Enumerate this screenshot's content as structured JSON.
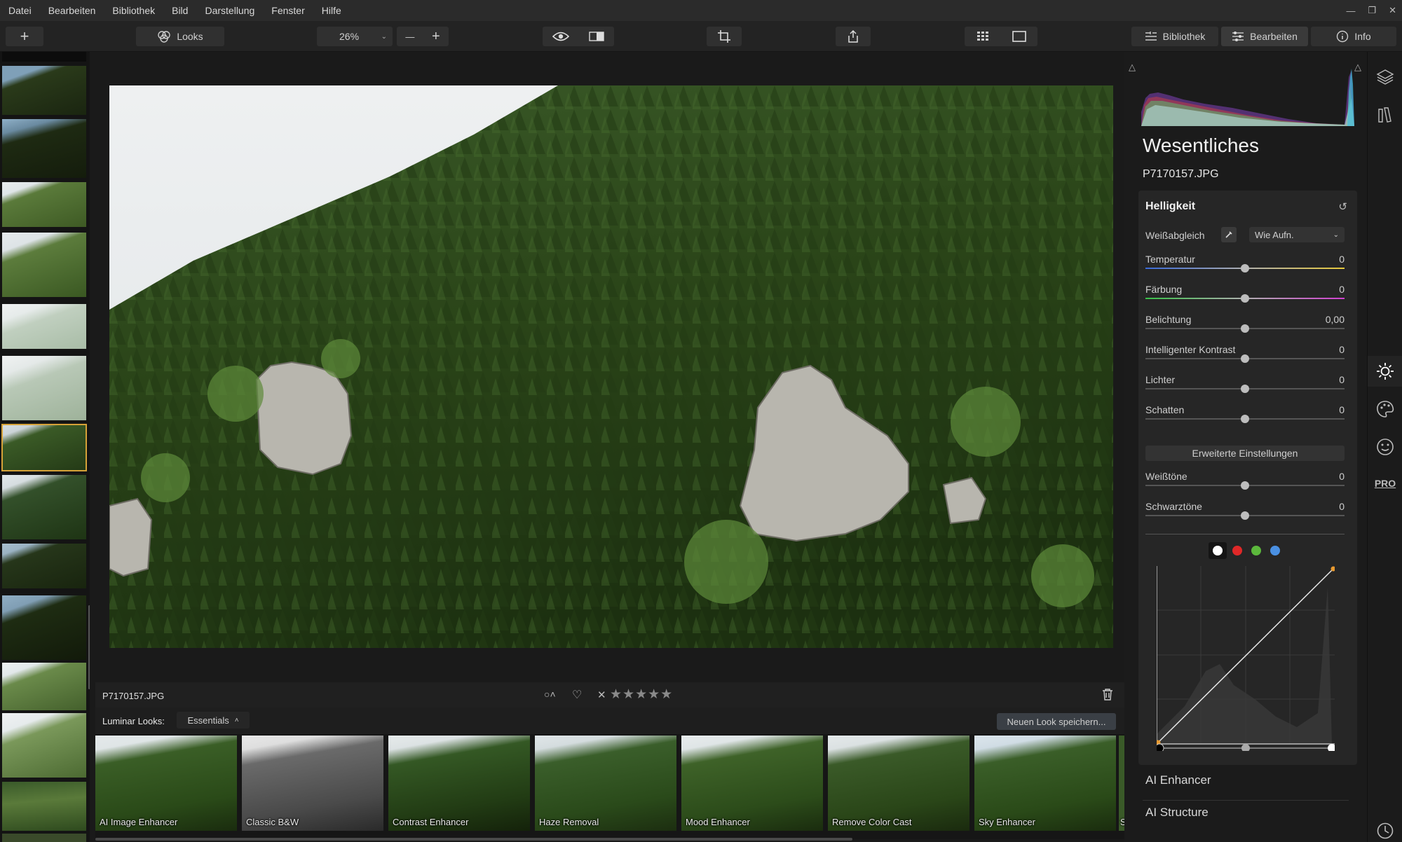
{
  "menu": [
    "Datei",
    "Bearbeiten",
    "Bibliothek",
    "Bild",
    "Darstellung",
    "Fenster",
    "Hilfe"
  ],
  "window_controls": {
    "minimize": "—",
    "maximize": "❐",
    "close": "✕"
  },
  "toolbar": {
    "add_label": "+",
    "looks_label": "Looks",
    "zoom_value": "26%",
    "zoom_out": "—",
    "zoom_in": "+",
    "tabs": {
      "library": "Bibliothek",
      "edit": "Bearbeiten",
      "info": "Info"
    }
  },
  "info_bar": {
    "filename": "P7170157.JPG",
    "rating_stars": "★★★★★",
    "reject": "✕",
    "rating": 0
  },
  "looks_bar": {
    "label": "Luminar Looks:",
    "category": "Essentials",
    "save_button": "Neuen Look speichern...",
    "items": [
      "AI Image Enhancer",
      "Classic B&W",
      "Contrast Enhancer",
      "Haze Removal",
      "Mood Enhancer",
      "Remove Color Cast",
      "Sky Enhancer",
      "Sc"
    ]
  },
  "panel": {
    "title": "Wesentliches",
    "filename": "P7170157.JPG",
    "section": "Helligkeit",
    "wb_label": "Weißabgleich",
    "wb_value": "Wie Aufn.",
    "sliders": [
      {
        "name": "Temperatur",
        "value": "0"
      },
      {
        "name": "Färbung",
        "value": "0"
      },
      {
        "name": "Belichtung",
        "value": "0,00"
      },
      {
        "name": "Intelligenter Kontrast",
        "value": "0"
      },
      {
        "name": "Lichter",
        "value": "0"
      },
      {
        "name": "Schatten",
        "value": "0"
      }
    ],
    "advanced_button": "Erweiterte Einstellungen",
    "advanced_sliders": [
      {
        "name": "Weißtöne",
        "value": "0"
      },
      {
        "name": "Schwarztöne",
        "value": "0"
      }
    ],
    "curve_channels": [
      "#ffffff",
      "#e02828",
      "#5cb83c",
      "#4a90e2"
    ],
    "collapsed_sections": [
      "AI Enhancer",
      "AI Structure"
    ],
    "pro_label": "PRO",
    "more_label": "•••"
  },
  "colors": {
    "accent": "#d6a238",
    "menubar": "#2b2b2b",
    "panel": "#262626"
  }
}
